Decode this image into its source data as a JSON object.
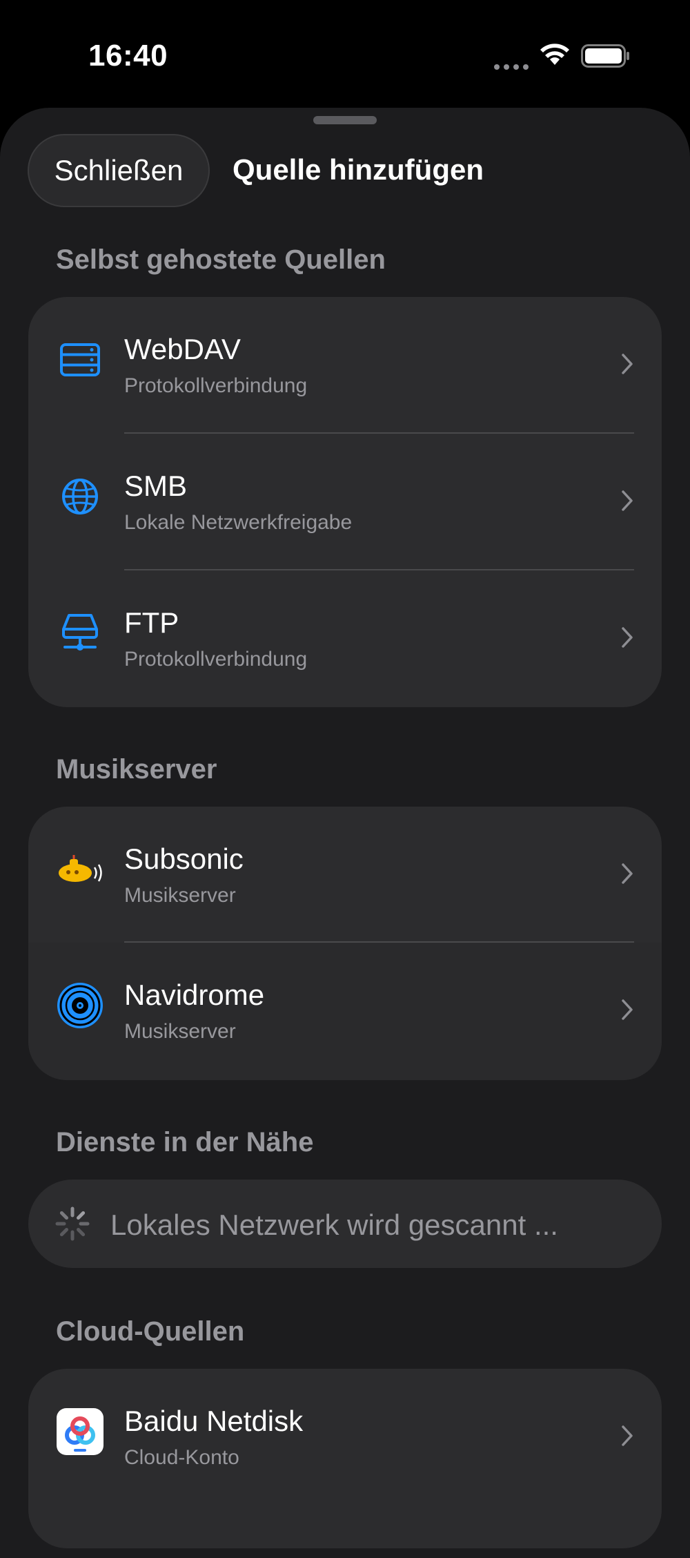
{
  "status_bar": {
    "time": "16:40"
  },
  "sheet": {
    "close_label": "Schließen",
    "title": "Quelle hinzufügen"
  },
  "sections": {
    "self_hosted": {
      "header": "Selbst gehostete Quellen",
      "items": [
        {
          "title": "WebDAV",
          "subtitle": "Protokollverbindung",
          "icon": "server-stack-icon"
        },
        {
          "title": "SMB",
          "subtitle": "Lokale Netzwerkfreigabe",
          "icon": "globe-icon"
        },
        {
          "title": "FTP",
          "subtitle": "Protokollverbindung",
          "icon": "network-drive-icon"
        }
      ]
    },
    "music_server": {
      "header": "Musikserver",
      "items": [
        {
          "title": "Subsonic",
          "subtitle": "Musikserver",
          "icon": "submarine-icon"
        },
        {
          "title": "Navidrome",
          "subtitle": "Musikserver",
          "icon": "vinyl-record-icon"
        }
      ]
    },
    "nearby": {
      "header": "Dienste in der Nähe",
      "scanning_text": "Lokales Netzwerk wird gescannt ..."
    },
    "cloud": {
      "header": "Cloud-Quellen",
      "items": [
        {
          "title": "Baidu Netdisk",
          "subtitle": "Cloud-Konto",
          "icon": "baidu-netdisk-icon"
        }
      ]
    }
  },
  "colors": {
    "background": "#1c1c1e",
    "card": "#2c2c2e",
    "accent_blue": "#1e90ff",
    "secondary_text": "#98989d"
  }
}
